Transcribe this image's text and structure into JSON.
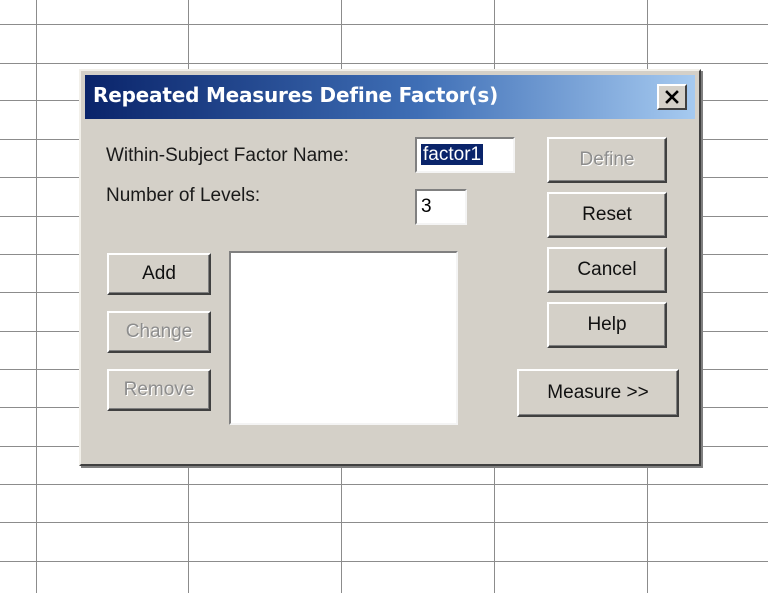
{
  "dialog": {
    "title": "Repeated Measures Define Factor(s)",
    "close_icon": "close-icon",
    "factor_name_label": "Within-Subject Factor Name:",
    "factor_name_value": "factor1",
    "levels_label": "Number of Levels:",
    "levels_value": "3",
    "buttons": {
      "add": "Add",
      "change": "Change",
      "remove": "Remove",
      "define": "Define",
      "reset": "Reset",
      "cancel": "Cancel",
      "help": "Help",
      "measure": "Measure >>"
    }
  },
  "colors": {
    "titlebar_start": "#0a246a",
    "titlebar_end": "#a6caf0",
    "dialog_face": "#d4d0c8",
    "selection": "#0a246a"
  }
}
